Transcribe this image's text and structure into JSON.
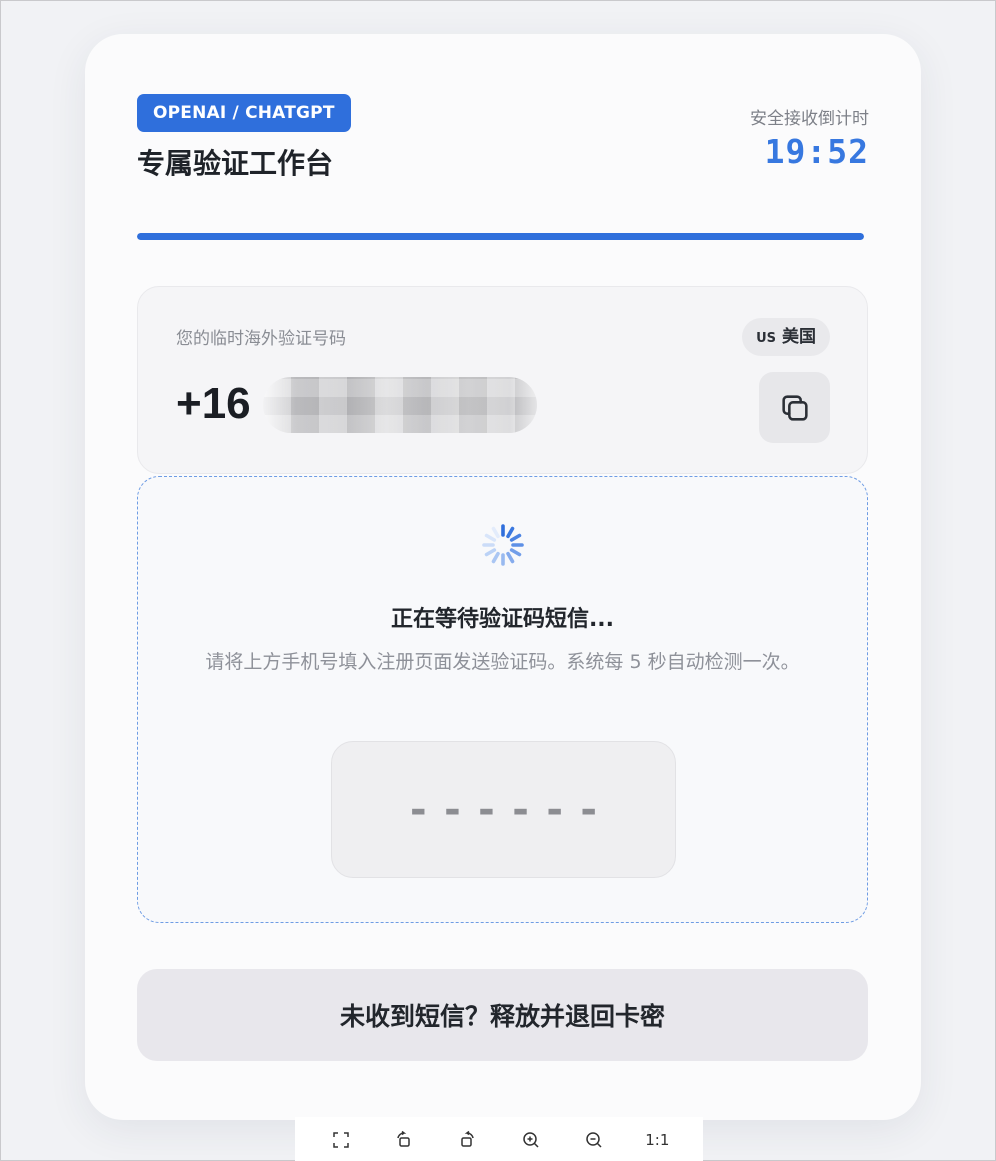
{
  "header": {
    "tag": "OPENAI / CHATGPT",
    "title": "专属验证工作台",
    "timer_label": "安全接收倒计时",
    "timer": "19:52",
    "progress": 1.0
  },
  "phone": {
    "label": "您的临时海外验证号码",
    "country_code": "US",
    "country_name": "美国",
    "number_prefix": "+16"
  },
  "waiting": {
    "title": "正在等待验证码短信...",
    "description": "请将上方手机号填入注册页面发送验证码。系统每 5 秒自动检测一次。",
    "code_placeholder": "------"
  },
  "actions": {
    "release_label": "未收到短信？释放并退回卡密"
  },
  "viewer_toolbar": {
    "actual_size_label": "1:1"
  },
  "colors": {
    "accent": "#2f6fdc",
    "timer": "#3778e0",
    "dashed_border": "#6e9ce4"
  }
}
